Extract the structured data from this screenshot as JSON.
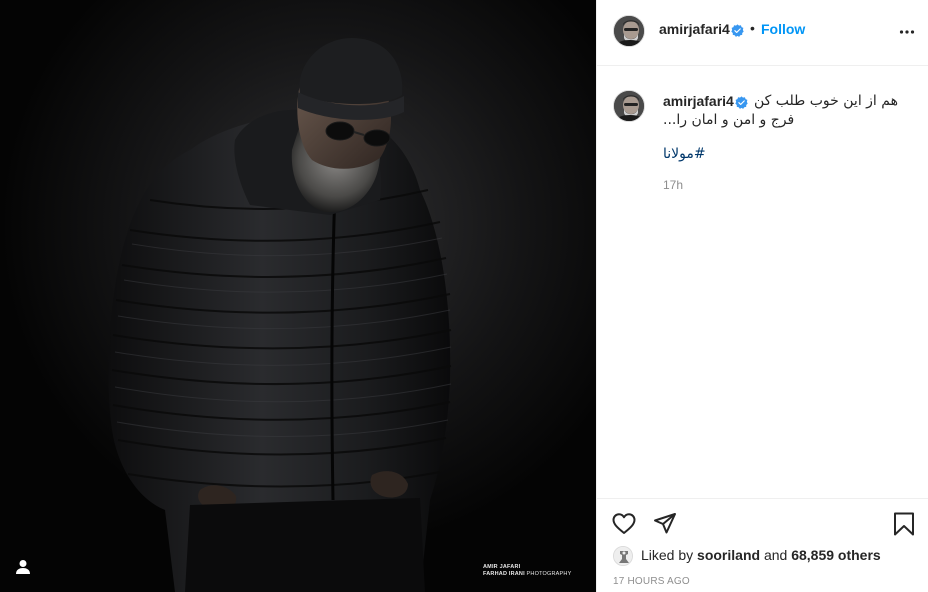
{
  "post": {
    "photo": {
      "description_icon": "tag-user-icon",
      "watermark_line1": "AMIR JAFARI",
      "watermark_line2_bold": "FARHAD IRANI",
      "watermark_line2_rest": " PHOTOGRAPHY"
    },
    "header": {
      "username": "amirjafari4",
      "separator": "•",
      "follow_label": "Follow",
      "icons": [
        "avatar",
        "verified-badge-icon",
        "more-options-icon"
      ]
    },
    "caption": {
      "username": "amirjafari4",
      "line1": "هم از این خوب طلب کن",
      "line2": "فرج و امن و امان را...",
      "hashtag": "#مولانا",
      "time": "17h"
    },
    "actions": {
      "icons": [
        "heart-icon",
        "share-icon",
        "bookmark-icon"
      ],
      "liked_by_prefix": "Liked by ",
      "liked_by_user": "sooriland",
      "liked_by_and": " and ",
      "liked_by_count": "68,859 others",
      "date": "17 HOURS AGO"
    },
    "colors": {
      "accent": "#0095f6",
      "hashtag": "#00376b",
      "text": "#262626",
      "muted": "#8e8e8e",
      "verified": "#3897f0",
      "border": "#efefef"
    }
  }
}
